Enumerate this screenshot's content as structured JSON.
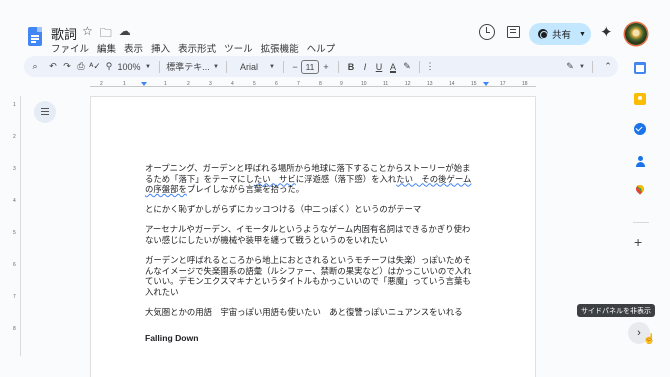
{
  "header": {
    "doc_title": "歌詞",
    "star_icon": "star-icon",
    "menu": [
      "ファイル",
      "編集",
      "表示",
      "挿入",
      "表示形式",
      "ツール",
      "拡張機能",
      "ヘルプ"
    ],
    "share_label": "共有"
  },
  "toolbar": {
    "zoom": "100%",
    "style": "標準テキ...",
    "font": "Arial",
    "font_size": "11",
    "bold": "B",
    "italic": "I",
    "underline": "U",
    "text_color": "A"
  },
  "ruler": {
    "marks": [
      "2",
      "1",
      "1",
      "2",
      "3",
      "4",
      "5",
      "6",
      "7",
      "8",
      "9",
      "10",
      "11",
      "12",
      "13",
      "14",
      "15",
      "17",
      "18"
    ],
    "vmarks": [
      "1",
      "2",
      "3",
      "4",
      "5",
      "6",
      "7",
      "8"
    ]
  },
  "document": {
    "paragraphs": [
      {
        "before": "オープニング、ガーデンと呼ばれる場所から地球に落下することからストーリーが始まるため「落下」をテーマにし",
        "underlined": "たい　サビ",
        "middle": "に浮遊感（落下感）を入れ",
        "underlined2": "たい　その後ゲームの序盤部を",
        "after": "プレイしながら言葉を拾った。"
      },
      {
        "text": "とにかく恥ずかしがらずにカッコつける（中二っぽく）というのがテーマ"
      },
      {
        "text": "アーセナルやガーデン、イモータルというようなゲーム内固有名詞はできるかぎり使わない感じにしたいが機械や装甲を纏って戦うというのをいれたい"
      },
      {
        "text": "ガーデンと呼ばれるところから地上におとされるというモチーフは失楽）っぽいためそんなイメージで失楽園系の語彙（ルシファー、禁断の果実など）はかっこいいので入れていい。デモンエクスマキナというタイトルもかっこいいので「悪魔」っていう言葉も入れたい"
      },
      {
        "text": "大気圏とかの用語　宇宙っぽい用語も使いたい　あと復讐っぽいニュアンスをいれる"
      }
    ],
    "heading": "Falling Down"
  },
  "sidepanel": {
    "tooltip": "サイドパネルを非表示",
    "add": "+",
    "expand": "›"
  },
  "colors": {
    "accent": "#4285f4",
    "share_bg": "#c2e7ff",
    "toolbar_bg": "#edf2fa"
  }
}
